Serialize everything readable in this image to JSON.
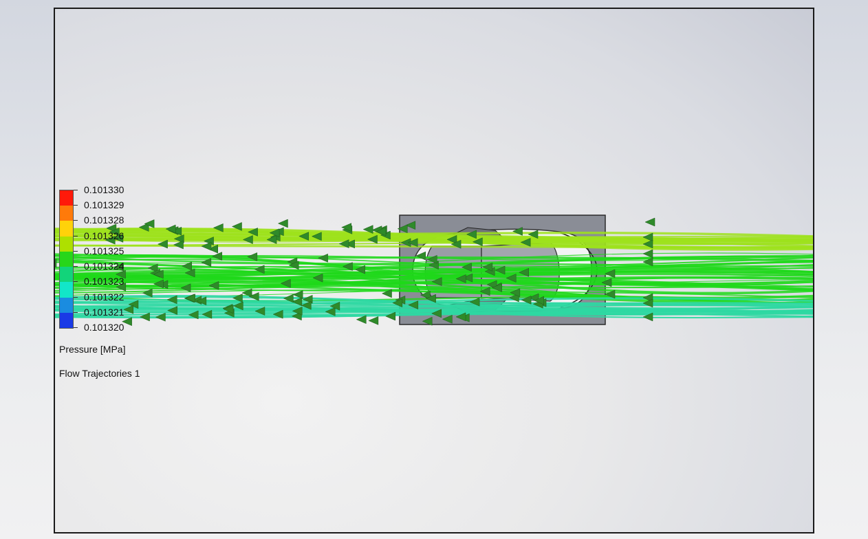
{
  "legend": {
    "title": "Pressure [MPa]",
    "values": [
      "0.101330",
      "0.101329",
      "0.101328",
      "0.101326",
      "0.101325",
      "0.101324",
      "0.101323",
      "0.101322",
      "0.101321",
      "0.101320"
    ],
    "colors": [
      "#ff1a0a",
      "#ff7a0a",
      "#ffd20a",
      "#aee000",
      "#27d61a",
      "#12d47a",
      "#12e6c8",
      "#1a8ce0",
      "#1a3ae6",
      "#1212f0"
    ]
  },
  "plot": {
    "name": "Flow Trajectories 1"
  },
  "model": {
    "body_color": "#8a8d96",
    "cavity_color": "#f3f3f5"
  },
  "streams": {
    "colors": {
      "upper": "#9ee21c",
      "middle": "#1ed81a",
      "lower": "#2ed8a2",
      "arrow": "#2f8a2a"
    }
  }
}
